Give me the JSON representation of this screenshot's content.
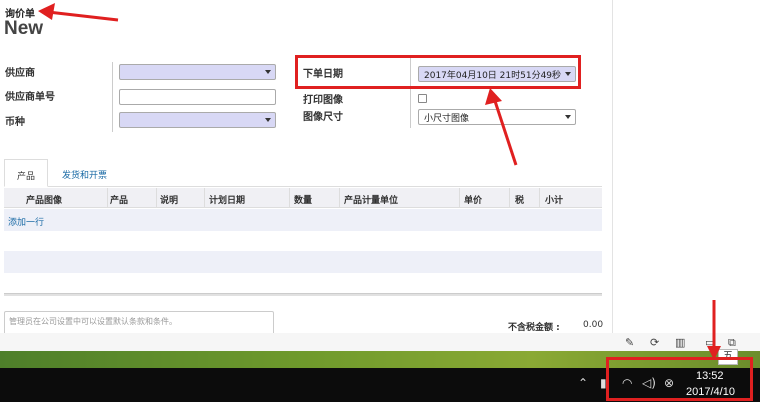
{
  "breadcrumb": "询价单",
  "title": "New",
  "form": {
    "vendor_label": "供应商",
    "vendor_ref_label": "供应商单号",
    "currency_label": "币种",
    "order_date_label": "下单日期",
    "order_date_value": "2017年04月10日 21时51分49秒",
    "print_image_label": "打印图像",
    "image_size_label": "图像尺寸",
    "image_size_value": "小尺寸图像"
  },
  "tabs": [
    "产品",
    "发货和开票"
  ],
  "grid": {
    "columns": [
      "产品图像",
      "产品",
      "说明",
      "计划日期",
      "数量",
      "产品计量单位",
      "单价",
      "税",
      "小计"
    ],
    "add_line": "添加一行"
  },
  "notes_placeholder": "管理员在公司设置中可以设置默认条款和条件。",
  "totals": {
    "untaxed_label": "不含税金额 :",
    "untaxed_value": "0.00"
  },
  "ime_label": "五",
  "taskbar": {
    "time": "13:52",
    "date": "2017/4/10"
  },
  "colors": {
    "annotation_red": "#e02020",
    "link_blue": "#1a6aa5",
    "select_bg": "#d8d8f5"
  }
}
